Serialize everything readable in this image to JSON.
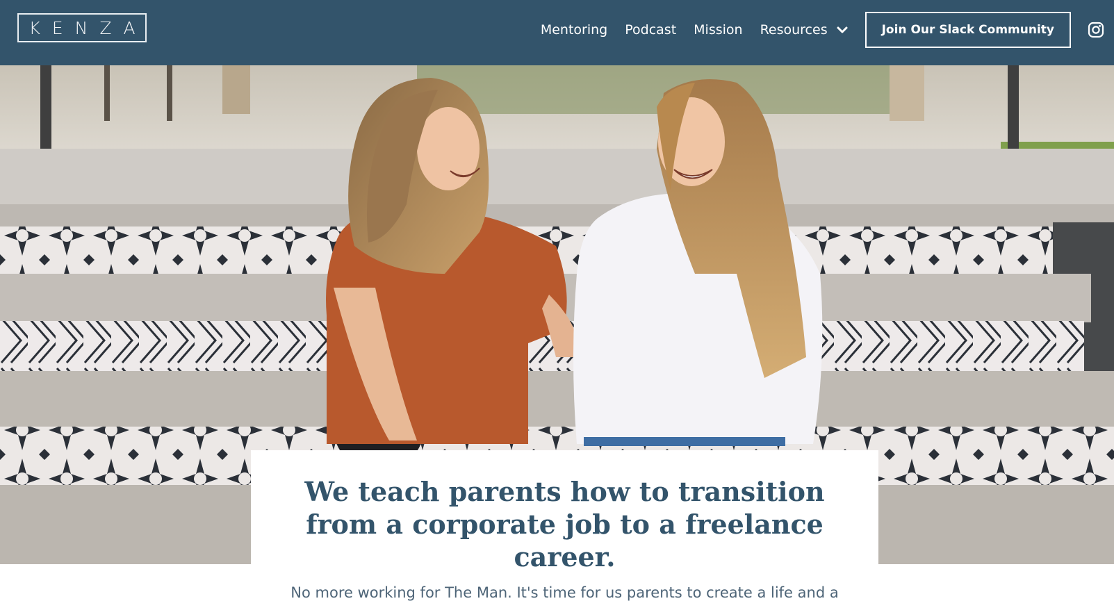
{
  "brand": {
    "logo_text": "KENZA"
  },
  "nav": {
    "items": [
      {
        "label": "Mentoring"
      },
      {
        "label": "Podcast"
      },
      {
        "label": "Mission"
      },
      {
        "label": "Resources"
      }
    ],
    "cta_label": "Join Our Slack Community",
    "icons": {
      "resources_dropdown": "chevron-down-icon",
      "social": "instagram-icon"
    }
  },
  "hero": {
    "photo_alt_subject": "two-women-laughing-on-tiled-steps",
    "headline": "We teach parents how to transition from a corporate job to a freelance career.",
    "subtext": "No more working for The Man. It's time for us parents to create a life and a"
  },
  "colors": {
    "header_bg": "#33546b",
    "headline": "#33546b",
    "card_bg": "#ffffff"
  }
}
